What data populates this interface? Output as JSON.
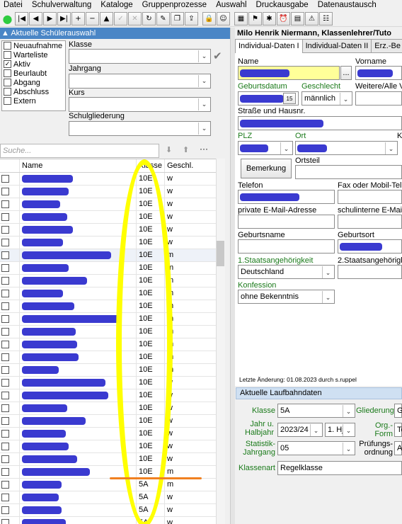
{
  "menu": [
    "Datei",
    "Schulverwaltung",
    "Kataloge",
    "Gruppenprozesse",
    "Auswahl",
    "Druckausgabe",
    "Datenaustausch"
  ],
  "toolbar_icons": [
    "status-green-icon",
    "first-record-icon",
    "previous-record-icon",
    "next-record-icon",
    "last-record-icon",
    "add-icon",
    "delete-icon",
    "up-icon",
    "confirm-icon",
    "cancel-icon",
    "refresh-icon",
    "tools-icon",
    "copy-icon",
    "export-icon",
    "lock-icon",
    "user-icon",
    "report-icon",
    "filter-icon",
    "chart-icon",
    "alarm-icon",
    "calendar-icon",
    "warning-icon",
    "group-icon"
  ],
  "filter": {
    "header": "Aktuelle Schülerauswahl",
    "statuses": [
      {
        "label": "Neuaufnahme",
        "checked": false
      },
      {
        "label": "Warteliste",
        "checked": false
      },
      {
        "label": "Aktiv",
        "checked": true
      },
      {
        "label": "Beurlaubt",
        "checked": false
      },
      {
        "label": "Abgang",
        "checked": false
      },
      {
        "label": "Abschluss",
        "checked": false
      },
      {
        "label": "Extern",
        "checked": false
      }
    ],
    "klasse_label": "Klasse",
    "jahrgang_label": "Jahrgang",
    "kurs_label": "Kurs",
    "schulgliederung_label": "Schulgliederung",
    "search_placeholder": "Suche..."
  },
  "grid": {
    "headers": {
      "name": "Name",
      "klasse": "Klasse",
      "geschlecht": "Geschl."
    },
    "rows": [
      {
        "klasse": "10E",
        "g": "w"
      },
      {
        "klasse": "10E",
        "g": "w"
      },
      {
        "klasse": "10E",
        "g": "w"
      },
      {
        "klasse": "10E",
        "g": "w"
      },
      {
        "klasse": "10E",
        "g": "w"
      },
      {
        "klasse": "10E",
        "g": "w"
      },
      {
        "klasse": "10E",
        "g": "m"
      },
      {
        "klasse": "10E",
        "g": "m"
      },
      {
        "klasse": "10E",
        "g": "m"
      },
      {
        "klasse": "10E",
        "g": "m"
      },
      {
        "klasse": "10E",
        "g": "m"
      },
      {
        "klasse": "10E",
        "g": "m"
      },
      {
        "klasse": "10E",
        "g": "m"
      },
      {
        "klasse": "10E",
        "g": "m"
      },
      {
        "klasse": "10E",
        "g": "m"
      },
      {
        "klasse": "10E",
        "g": "m"
      },
      {
        "klasse": "10E",
        "g": "w"
      },
      {
        "klasse": "10E",
        "g": "w"
      },
      {
        "klasse": "10E",
        "g": "w"
      },
      {
        "klasse": "10E",
        "g": "w"
      },
      {
        "klasse": "10E",
        "g": "w"
      },
      {
        "klasse": "10E",
        "g": "w"
      },
      {
        "klasse": "10E",
        "g": "w"
      },
      {
        "klasse": "10E",
        "g": "m"
      },
      {
        "klasse": "5A",
        "g": "m"
      },
      {
        "klasse": "5A",
        "g": "w"
      },
      {
        "klasse": "5A",
        "g": "w"
      },
      {
        "klasse": "5A",
        "g": "w"
      }
    ]
  },
  "student": {
    "title": "Milo Henrik Niermann, Klassenlehrer/Tuto",
    "tabs": [
      "Individual-Daten I",
      "Individual-Daten II",
      "Erz.-Be"
    ],
    "name_label": "Name",
    "vorname_label": "Vorname",
    "browse_button": "...",
    "geburtsdatum_label": "Geburtsdatum",
    "geschlecht_label": "Geschlecht",
    "geschlecht_value": "männlich",
    "calendar_button": "15",
    "weitere_label": "Weitere/Alle V",
    "strasse_label": "Straße und Hausnr.",
    "plz_label": "PLZ",
    "ort_label": "Ort",
    "k_label": "K",
    "bemerkung_button": "Bemerkung",
    "ortsteil_label": "Ortsteil",
    "telefon_label": "Telefon",
    "fax_label": "Fax oder Mobil-Tele",
    "email_private_label": "private E-Mail-Adresse",
    "email_school_label": "schulinterne E-Mail-",
    "geburtsname_label": "Geburtsname",
    "geburtsort_label": "Geburtsort",
    "staat1_label": "1.Staatsangehörigkeit",
    "staat1_value": "Deutschland",
    "staat2_label": "2.Staatsangehörigk",
    "konfession_label": "Konfession",
    "konfession_value": "ohne Bekenntnis",
    "last_change": "Letzte Änderung: 01.08.2023 durch s.ruppel"
  },
  "laufbahn": {
    "header": "Aktuelle Laufbahndaten",
    "klasse_label": "Klasse",
    "klasse_value": "5A",
    "gliederung_label": "Gliederung",
    "gliederung_value": "G",
    "jahr_label": "Jahr u. Halbjahr",
    "jahr_value": "2023/24",
    "halbjahr_value": "1. Hj",
    "orgform_label": "Org.-Form",
    "orgform_value": "Te",
    "statistik_label": "Statistik-Jahrgang",
    "statistik_value": "05",
    "pruefung_label": "Prüfungs-ordnung",
    "pruefung_value": "A",
    "klassenart_label": "Klassenart",
    "klassenart_value": "Regelklasse"
  }
}
